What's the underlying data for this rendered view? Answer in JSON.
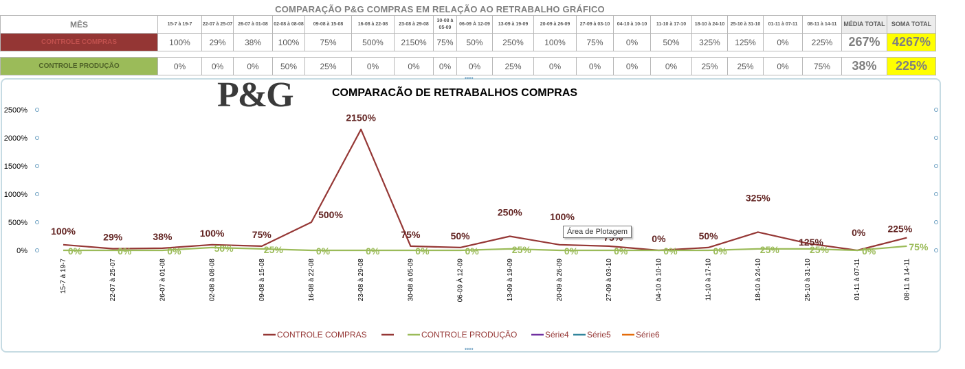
{
  "sheet": {
    "title": "COMPARAÇÃO P&G  COMPRAS EM RELAÇÃO AO RETRABALHO GRÁFICO",
    "month_header": "MÊS",
    "date_headers": [
      "15-7 à 19-7",
      "22-07 à 25-07",
      "26-07 à 01-08",
      "02-08 à 08-08",
      "09-08 à 15-08",
      "16-08 à 22-08",
      "23-08 à 29-08",
      "30-08 à 05-09",
      "06-09 À 12-09",
      "13-09 à 19-09",
      "20-09 à 26-09",
      "27-09 à 03-10",
      "04-10 à 10-10",
      "11-10 à 17-10",
      "18-10 à 24-10",
      "25-10 à 31-10",
      "01-11 à 07-11",
      "08-11 à 14-11"
    ],
    "avg_header": "MÉDIA TOTAL",
    "sum_header": "SOMA TOTAL",
    "rows": [
      {
        "label": "CONTROLE COMPRAS",
        "values": [
          "100%",
          "29%",
          "38%",
          "100%",
          "75%",
          "500%",
          "2150%",
          "75%",
          "50%",
          "250%",
          "100%",
          "75%",
          "0%",
          "50%",
          "325%",
          "125%",
          "0%",
          "225%"
        ],
        "avg": "267%",
        "sum": "4267%"
      },
      {
        "label": "CONTROLE PRODUÇÃO",
        "values": [
          "0%",
          "0%",
          "0%",
          "50%",
          "25%",
          "0%",
          "0%",
          "0%",
          "0%",
          "25%",
          "0%",
          "0%",
          "0%",
          "0%",
          "25%",
          "25%",
          "0%",
          "75%"
        ],
        "avg": "38%",
        "sum": "225%"
      }
    ]
  },
  "chart_data": {
    "type": "line",
    "title": "COMPARACÃO DE RETRABALHOS  COMPRAS",
    "logo": "P&G",
    "categories": [
      "15-7 à 19-7",
      "22-07 à 25-07",
      "26-07 à 01-08",
      "02-08 à 08-08",
      "09-08 à 15-08",
      "16-08 à 22-08",
      "23-08 à 29-08",
      "30-08 à 05-09",
      "06-09 À 12-09",
      "13-09 à 19-09",
      "20-09 à 26-09",
      "27-09 à 03-10",
      "04-10 à 10-10",
      "11-10 à 17-10",
      "18-10 à 24-10",
      "25-10 à 31-10",
      "01-11 à 07-11",
      "08-11 à 14-11"
    ],
    "series": [
      {
        "name": "CONTROLE COMPRAS",
        "color": "#953735",
        "values": [
          100,
          29,
          38,
          100,
          75,
          500,
          2150,
          75,
          50,
          250,
          100,
          75,
          0,
          50,
          325,
          125,
          0,
          225
        ]
      },
      {
        "name": "CONTROLE PRODUÇÃO",
        "color": "#9bbb59",
        "values": [
          0,
          0,
          0,
          50,
          25,
          0,
          0,
          0,
          0,
          25,
          0,
          0,
          0,
          0,
          25,
          25,
          0,
          75
        ]
      }
    ],
    "legend": [
      {
        "name": "CONTROLE COMPRAS",
        "color": "#953735"
      },
      {
        "name": "",
        "color": "#953735"
      },
      {
        "name": "CONTROLE PRODUÇÃO",
        "color": "#9bbb59"
      },
      {
        "name": "Série4",
        "color": "#7030a0"
      },
      {
        "name": "Série5",
        "color": "#31859c"
      },
      {
        "name": "Série6",
        "color": "#e46c0a"
      }
    ],
    "legend_position": "bottom",
    "y_ticks": [
      "0%",
      "500%",
      "1000%",
      "1500%",
      "2000%",
      "2500%"
    ],
    "ylim": [
      0,
      2500
    ],
    "grid": false,
    "tooltip": "Área de Plotagem"
  }
}
